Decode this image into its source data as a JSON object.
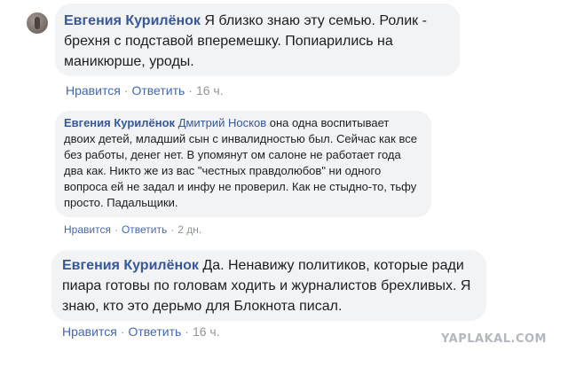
{
  "comments": [
    {
      "author": "Евгения Курилёнок",
      "text": " Я близко знаю эту семью. Ролик - брехня с подставой вперемешку. Попиарились на маникюрше, уроды.",
      "like": "Нравится",
      "reply": "Ответить",
      "time": "16 ч."
    },
    {
      "author": "Евгения Курилёнок",
      "mention": "Дмитрий Носков",
      "text": " она одна воспитывает двоих детей, младший сын с инвалидностью был. Сейчас как все без работы, денег нет. В упомянут ом салоне не работает года два как. Никто же из вас \"честных правдолюбов\" ни одного вопроса ей не задал и инфу не проверил. Как не стыдно-то, тьфу просто. Падальщики.",
      "like": "Нравится",
      "reply": "Ответить",
      "time": "2 дн."
    },
    {
      "author": "Евгения Курилёнок",
      "text": " Да. Ненавижу политиков, которые ради пиара готовы по головам ходить и журналистов брехливых. Я знаю, кто это дерьмо для Блокнота писал.",
      "like": "Нравится",
      "reply": "Ответить",
      "time": "16 ч."
    }
  ],
  "separator": "·",
  "watermark": "YAPLAKAL.COM"
}
